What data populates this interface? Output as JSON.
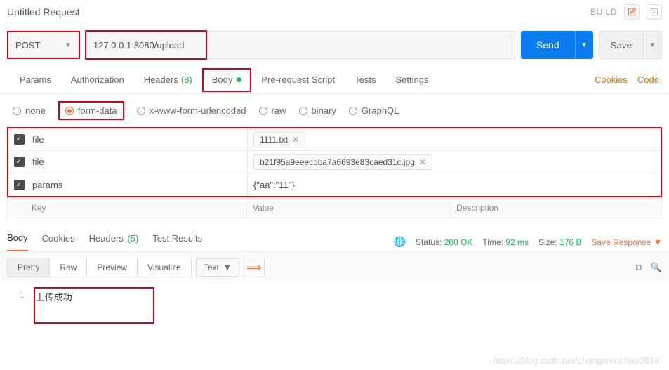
{
  "header": {
    "title": "Untitled Request",
    "build": "BUILD"
  },
  "request": {
    "method": "POST",
    "url": "127.0.0.1:8080/upload",
    "send": "Send",
    "save": "Save"
  },
  "tabs": {
    "params": "Params",
    "auth": "Authorization",
    "headers": "Headers",
    "headers_count": "(8)",
    "body": "Body",
    "prerequest": "Pre-request Script",
    "tests": "Tests",
    "settings": "Settings",
    "cookies": "Cookies",
    "code": "Code"
  },
  "body_types": {
    "none": "none",
    "formdata": "form-data",
    "urlencoded": "x-www-form-urlencoded",
    "raw": "raw",
    "binary": "binary",
    "graphql": "GraphQL"
  },
  "form_rows": [
    {
      "key": "file",
      "file": "1111.txt"
    },
    {
      "key": "file",
      "file": "b21f95a9eeecbba7a6693e83caed31c.jpg"
    },
    {
      "key": "params",
      "text": "{\"aa\":\"11\"}"
    }
  ],
  "kvd": {
    "key": "Key",
    "value": "Value",
    "desc": "Description"
  },
  "response": {
    "tabs": {
      "body": "Body",
      "cookies": "Cookies",
      "headers": "Headers",
      "headers_count": "(5)",
      "tests": "Test Results"
    },
    "status_label": "Status:",
    "status_val": "200 OK",
    "time_label": "Time:",
    "time_val": "92 ms",
    "size_label": "Size:",
    "size_val": "176 B",
    "save": "Save Response"
  },
  "viewer": {
    "pretty": "Pretty",
    "raw": "Raw",
    "preview": "Preview",
    "visualize": "Visualize",
    "format": "Text"
  },
  "code": {
    "line_no": "1",
    "text": "上传成功"
  },
  "watermark": "https://blog.csdn.net/zhangwenchao0814"
}
